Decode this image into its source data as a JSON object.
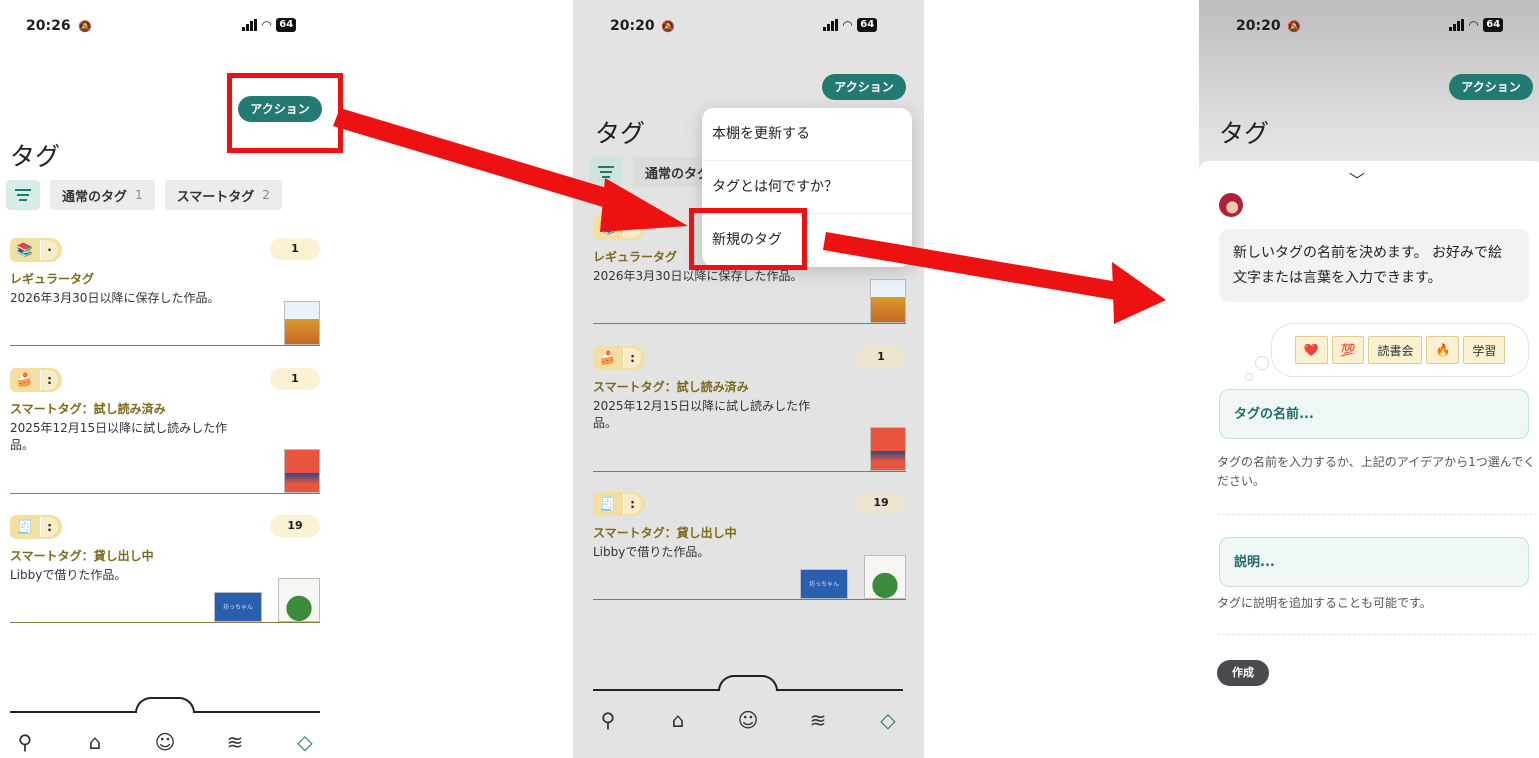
{
  "status": {
    "panel1": {
      "time": "20:26",
      "battery": "64"
    },
    "panel2": {
      "time": "20:20",
      "battery": "64"
    },
    "panel3": {
      "time": "20:20",
      "battery": "64"
    }
  },
  "header": {
    "action_label": "アクション",
    "title": "タグ"
  },
  "filters": {
    "regular": {
      "label": "通常のタグ",
      "count": "1"
    },
    "smart": {
      "label": "スマートタグ",
      "count": "2"
    }
  },
  "tags": [
    {
      "emoji": "📚",
      "dots": "·",
      "count": "1",
      "name": "レギュラータグ",
      "desc": "2026年3月30日以降に保存した作品。"
    },
    {
      "emoji": "🍰",
      "dots": ":",
      "count": "1",
      "name": "スマートタグ：試し読み済み",
      "desc": "2025年12月15日以降に試し読みした作品。"
    },
    {
      "emoji": "🧾",
      "dots": ":",
      "count": "19",
      "name": "スマートタグ：貸し出し中",
      "desc": "Libbyで借りた作品。"
    }
  ],
  "covers": {
    "bochan": "坊っちゃん"
  },
  "menu": {
    "items": [
      "本棚を更新する",
      "タグとは何ですか？",
      "新規のタグ"
    ]
  },
  "sheet": {
    "intro": "新しいタグの名前を決めます。 お好みで絵文字または言葉を入力できます。",
    "ideas": [
      "❤️",
      "💯",
      "読書会",
      "🔥",
      "学習"
    ],
    "name_placeholder": "タグの名前...",
    "name_hint": "タグの名前を入力するか、上記のアイデアから1つ選んでください。",
    "desc_placeholder": "説明...",
    "desc_hint": "タグに説明を追加することも可能です。",
    "create_label": "作成"
  },
  "colors": {
    "accent": "#237a72",
    "highlight": "#ee1111",
    "tag_name": "#7a6a1a"
  }
}
